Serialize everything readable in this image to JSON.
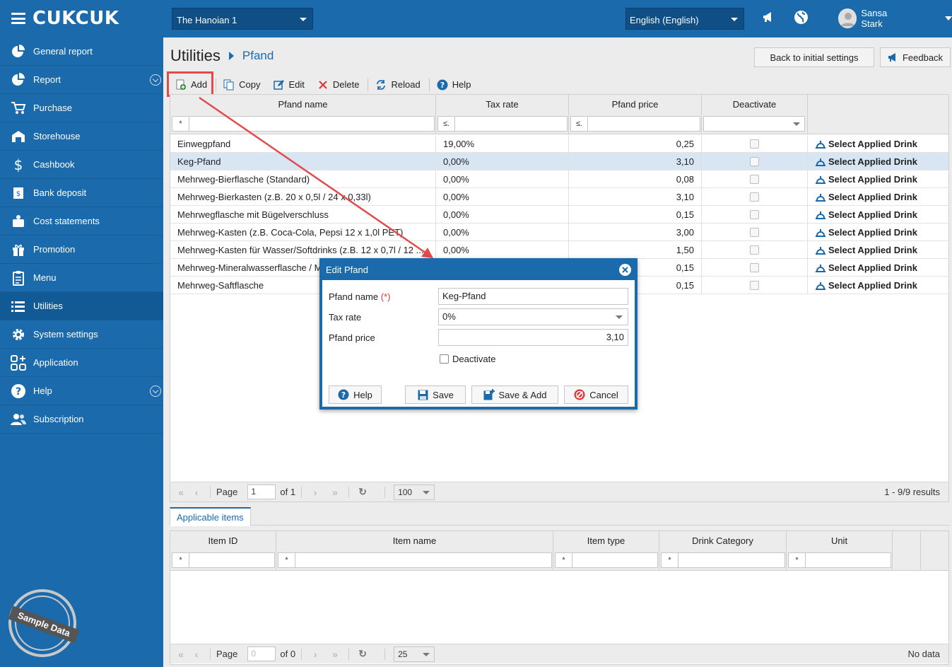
{
  "app": {
    "logo_text": "CUKCUK"
  },
  "header": {
    "branch": "The Hanoian 1",
    "language": "English (English)",
    "user_name": "Sansa Stark",
    "icons": [
      "announcement-icon",
      "globe-icon",
      "user-avatar",
      "chevron-down-icon"
    ]
  },
  "sidebar": {
    "items": [
      {
        "label": "General report",
        "icon": "pie-chart-icon"
      },
      {
        "label": "Report",
        "icon": "report-icon",
        "expandable": true
      },
      {
        "label": "Purchase",
        "icon": "cart-icon"
      },
      {
        "label": "Storehouse",
        "icon": "storehouse-icon"
      },
      {
        "label": "Cashbook",
        "icon": "dollar-icon"
      },
      {
        "label": "Bank deposit",
        "icon": "bank-icon"
      },
      {
        "label": "Cost statements",
        "icon": "money-bag-icon"
      },
      {
        "label": "Promotion",
        "icon": "gift-icon"
      },
      {
        "label": "Menu",
        "icon": "clipboard-icon"
      },
      {
        "label": "Utilities",
        "icon": "list-icon",
        "active": true
      },
      {
        "label": "System settings",
        "icon": "gear-icon"
      },
      {
        "label": "Application",
        "icon": "apps-icon"
      },
      {
        "label": "Help",
        "icon": "help-icon",
        "expandable": true
      },
      {
        "label": "Subscription",
        "icon": "users-icon"
      }
    ],
    "sample_badge": "Sample Data"
  },
  "page": {
    "title": "Utilities",
    "current": "Pfand",
    "reset_button": "Back to initial settings",
    "feedback_button": "Feedback"
  },
  "toolbar": {
    "add": "Add",
    "copy": "Copy",
    "edit": "Edit",
    "delete": "Delete",
    "reload": "Reload",
    "help": "Help"
  },
  "grid": {
    "columns": [
      "Pfand name",
      "Tax rate",
      "Pfand price",
      "Deactivate"
    ],
    "filters": {
      "name_op": "*",
      "tax_op": "≤.",
      "price_op": "≤."
    },
    "action_label": "Select Applied Drink",
    "selected_row": 1,
    "rows": [
      {
        "name": "Einwegpfand",
        "tax": "19,00%",
        "price": "0,25",
        "deactivated": false
      },
      {
        "name": "Keg-Pfand",
        "tax": "0,00%",
        "price": "3,10",
        "deactivated": false
      },
      {
        "name": "Mehrweg-Bierflasche (Standard)",
        "tax": "0,00%",
        "price": "0,08",
        "deactivated": false
      },
      {
        "name": "Mehrweg-Bierkasten (z.B. 20 x 0,5l / 24 x 0,33l)",
        "tax": "0,00%",
        "price": "3,10",
        "deactivated": false
      },
      {
        "name": "Mehrwegflasche mit Bügelverschluss",
        "tax": "0,00%",
        "price": "0,15",
        "deactivated": false
      },
      {
        "name": "Mehrweg-Kasten (z.B. Coca-Cola, Pepsi 12 x 1,0l PET)",
        "tax": "0,00%",
        "price": "3,00",
        "deactivated": false
      },
      {
        "name": "Mehrweg-Kasten für Wasser/Softdrinks (z.B. 12 x 0,7l / 12 ...",
        "tax": "0,00%",
        "price": "1,50",
        "deactivated": false
      },
      {
        "name": "Mehrweg-Mineralwasserflasche / M",
        "tax": "",
        "price": "0,15",
        "deactivated": false
      },
      {
        "name": "Mehrweg-Saftflasche",
        "tax": "",
        "price": "0,15",
        "deactivated": false
      }
    ],
    "pager": {
      "page_label": "Page",
      "page": "1",
      "of": "of 1",
      "page_size": "100",
      "info": "1 - 9/9 results"
    }
  },
  "subgrid": {
    "tab": "Applicable items",
    "columns": [
      "Item ID",
      "Item name",
      "Item type",
      "Drink Category",
      "Unit"
    ],
    "filter_op": "*",
    "pager": {
      "page_label": "Page",
      "page": "0",
      "of": "of 0",
      "page_size": "25",
      "info": "No data"
    }
  },
  "dialog": {
    "title": "Edit Pfand",
    "name_label": "Pfand name",
    "required_mark": "(*)",
    "name_value": "Keg-Pfand",
    "tax_label": "Tax rate",
    "tax_value": "0%",
    "price_label": "Pfand price",
    "price_value": "3,10",
    "deactivate_label": "Deactivate",
    "buttons": {
      "help": "Help",
      "save": "Save",
      "save_add": "Save & Add",
      "cancel": "Cancel"
    }
  },
  "colors": {
    "primary": "#1a6aac",
    "highlight": "#e34a4a",
    "selected_row": "#d8e6f4"
  }
}
